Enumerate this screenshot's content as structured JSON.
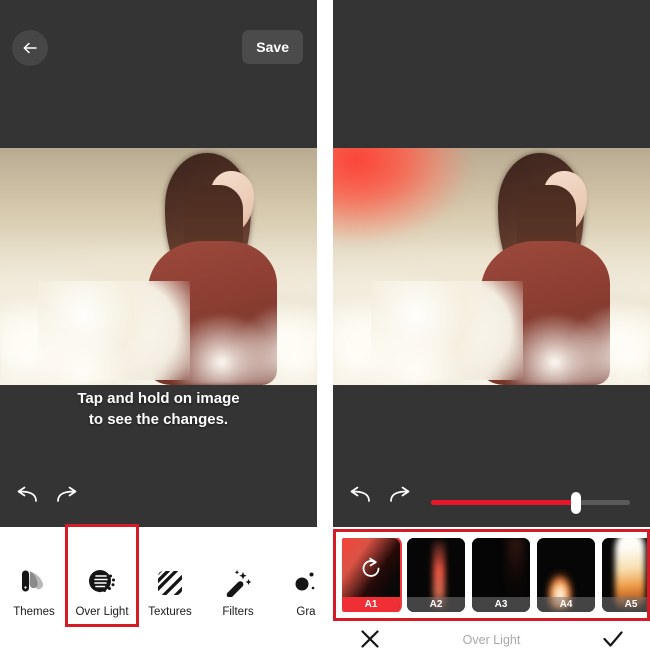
{
  "app": {
    "gap_color": "#ffffff",
    "editor_bg": "#343434",
    "accent_red": "#d51b26",
    "slider_red": "#e8152a"
  },
  "left_screen": {
    "topbar": {
      "back_icon": "arrow-left-icon",
      "save_label": "Save"
    },
    "photo": {
      "alt": "young woman in red sweater standing in a field of white flowers"
    },
    "hint": {
      "line1": "Tap and hold on image",
      "line2": "to see the changes."
    },
    "history": {
      "undo_icon": "undo-arrow-icon",
      "redo_icon": "redo-arrow-icon"
    },
    "tools": [
      {
        "label": "Themes",
        "icon": "themes-fan-icon",
        "selected": false
      },
      {
        "label": "Over Light",
        "icon": "over-light-icon",
        "selected": true
      },
      {
        "label": "Textures",
        "icon": "textures-stripes-icon",
        "selected": false
      },
      {
        "label": "Filters",
        "icon": "magic-wand-icon",
        "selected": false
      },
      {
        "label": "Gra",
        "icon": "grain-dots-icon",
        "selected": false
      }
    ]
  },
  "right_screen": {
    "photo": {
      "alt": "same portrait with a red over-light flare applied on the upper left"
    },
    "history": {
      "undo_icon": "undo-arrow-icon",
      "redo_icon": "redo-arrow-icon"
    },
    "slider": {
      "name": "intensity-slider",
      "value_percent": 73,
      "fill_color": "#e8152a",
      "track_color": "#5a5a5a"
    },
    "filters": [
      {
        "label": "A1",
        "selected": true,
        "icon": "reset-circle-arrow-icon",
        "art": "art-a1"
      },
      {
        "label": "A2",
        "selected": false,
        "art": "art-a2"
      },
      {
        "label": "A3",
        "selected": false,
        "art": "art-a3"
      },
      {
        "label": "A4",
        "selected": false,
        "art": "art-a4"
      },
      {
        "label": "A5",
        "selected": false,
        "art": "art-a5"
      },
      {
        "label": "",
        "selected": false,
        "art": "art-a6"
      }
    ],
    "actionbar": {
      "cancel_icon": "close-x-icon",
      "title": "Over Light",
      "confirm_icon": "check-icon"
    }
  }
}
